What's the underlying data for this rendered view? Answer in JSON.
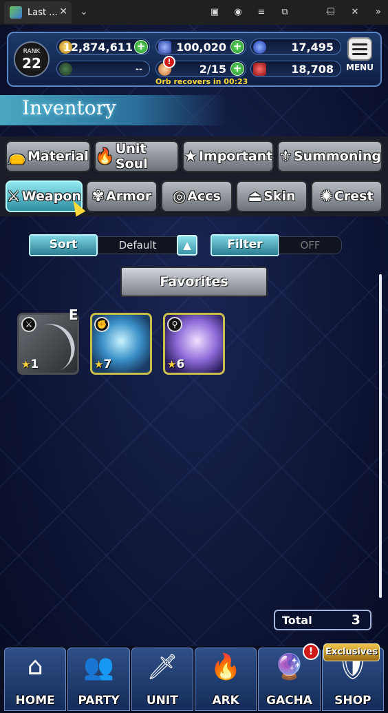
{
  "window": {
    "tab_title": "Last ...",
    "tab_close": "✕"
  },
  "hud": {
    "rank_label": "RANK",
    "rank_value": "22",
    "gold": "12,874,611",
    "gems": "100,020",
    "blue_orbs": "17,495",
    "slot_empty": "--",
    "orbs": "2/15",
    "ruby": "18,708",
    "orb_recover_note": "Orb recovers in 00:23",
    "menu_label": "MENU"
  },
  "page": {
    "title": "Inventory"
  },
  "categories_row1": [
    {
      "label": "Material",
      "icon": "sack-icon"
    },
    {
      "label": "Unit Soul",
      "icon": "flame-icon"
    },
    {
      "label": "Important",
      "icon": "star-icon"
    },
    {
      "label": "Summoning",
      "icon": "scroll-icon"
    }
  ],
  "categories_row2": [
    {
      "label": "Weapon",
      "icon": "sword-icon",
      "active": true
    },
    {
      "label": "Armor",
      "icon": "armor-icon"
    },
    {
      "label": "Accs",
      "icon": "ring-icon"
    },
    {
      "label": "Skin",
      "icon": "hanger-icon"
    },
    {
      "label": "Crest",
      "icon": "crest-icon"
    }
  ],
  "controls": {
    "sort_label": "Sort",
    "sort_value": "Default",
    "sort_arrow": "▲",
    "filter_label": "Filter",
    "filter_value": "OFF"
  },
  "favorites_label": "Favorites",
  "items": [
    {
      "type_icon": "sword-icon",
      "rarity": "1",
      "equipped": "E"
    },
    {
      "type_icon": "fist-icon",
      "rarity": "7"
    },
    {
      "type_icon": "staff-icon",
      "rarity": "6"
    }
  ],
  "total": {
    "label": "Total",
    "value": "3"
  },
  "nav": [
    {
      "label": "HOME"
    },
    {
      "label": "PARTY"
    },
    {
      "label": "UNIT"
    },
    {
      "label": "ARK"
    },
    {
      "label": "GACHA"
    },
    {
      "label": "SHOP"
    }
  ],
  "shop_badge": "Exclusives",
  "alert_mark": "!",
  "colors": {
    "accent": "#2a8ea0",
    "gold_text": "#ffd83a",
    "plus_green": "#1d8a23"
  }
}
